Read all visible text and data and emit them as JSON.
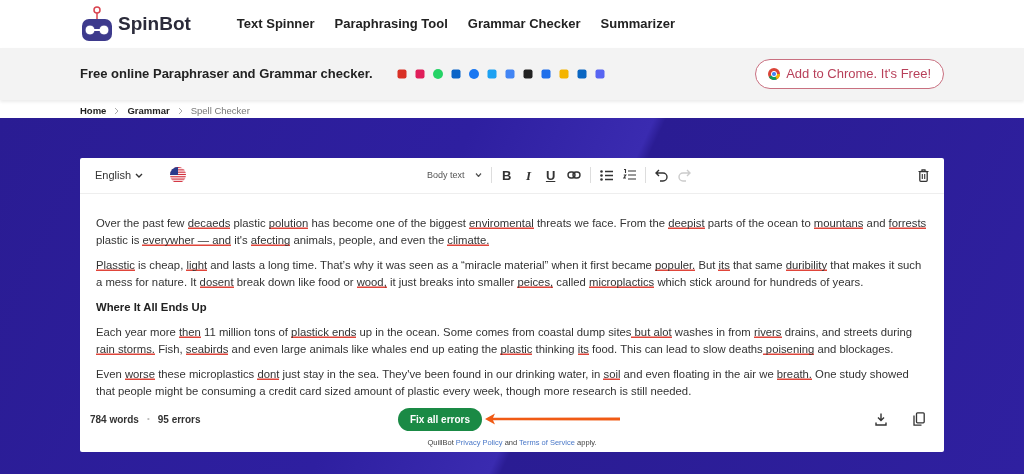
{
  "header": {
    "brand": "SpinBot",
    "nav": [
      {
        "label": "Text Spinner"
      },
      {
        "label": "Paraphrasing Tool"
      },
      {
        "label": "Grammar Checker"
      },
      {
        "label": "Summarizer"
      }
    ]
  },
  "promo": {
    "tagline": "Free online Paraphraser and Grammar checker.",
    "cta": "Add to Chrome. It's Free!"
  },
  "breadcrumb": [
    {
      "label": "Home",
      "current": false
    },
    {
      "label": "Grammar",
      "current": false
    },
    {
      "label": "Spell Checker",
      "current": true
    }
  ],
  "editor": {
    "language": "English",
    "text_style": "Body text",
    "format_buttons": [
      "B",
      "I",
      "U"
    ],
    "history": [
      {
        "kind": "undo",
        "disabled": false
      },
      {
        "kind": "redo",
        "disabled": true
      }
    ],
    "paragraphs": [
      {
        "kind": "text",
        "segments": [
          {
            "text": "Over the past few ",
            "error": false
          },
          {
            "text": "decaeds",
            "error": true
          },
          {
            "text": " plastic ",
            "error": false
          },
          {
            "text": "polution",
            "error": true
          },
          {
            "text": " has become one of the biggest ",
            "error": false
          },
          {
            "text": "enviromental",
            "error": true
          },
          {
            "text": " threats we face. From the ",
            "error": false
          },
          {
            "text": "deepist",
            "error": true
          },
          {
            "text": " parts of the ocean to ",
            "error": false
          },
          {
            "text": "mountans",
            "error": true
          },
          {
            "text": " and ",
            "error": false
          },
          {
            "text": "forrests",
            "error": true
          },
          {
            "text": " plastic is ",
            "error": false
          },
          {
            "text": "everywher — and",
            "error": true
          },
          {
            "text": " it's ",
            "error": false
          },
          {
            "text": "afecting",
            "error": true
          },
          {
            "text": " animals, people, and even the ",
            "error": false
          },
          {
            "text": "climatte.",
            "error": true
          }
        ]
      },
      {
        "kind": "text",
        "segments": [
          {
            "text": "Plasstic",
            "error": true
          },
          {
            "text": " is cheap, ",
            "error": false
          },
          {
            "text": "light",
            "error": true
          },
          {
            "text": " and lasts a long time. That’s why it was seen as a “miracle material” when it first became ",
            "error": false
          },
          {
            "text": "populer.",
            "error": true
          },
          {
            "text": " But ",
            "error": false
          },
          {
            "text": "its",
            "error": true
          },
          {
            "text": " that same ",
            "error": false
          },
          {
            "text": "duribility",
            "error": true
          },
          {
            "text": " that makes it such a mess for nature. It ",
            "error": false
          },
          {
            "text": "dosent",
            "error": true
          },
          {
            "text": " break down like food or ",
            "error": false
          },
          {
            "text": "wood,",
            "error": true
          },
          {
            "text": " it just breaks into smaller ",
            "error": false
          },
          {
            "text": "peices,",
            "error": true
          },
          {
            "text": " called ",
            "error": false
          },
          {
            "text": "microplactics",
            "error": true
          },
          {
            "text": " which stick around for hundreds of years.",
            "error": false
          }
        ]
      },
      {
        "kind": "heading",
        "text": "Where It All Ends Up"
      },
      {
        "kind": "text",
        "segments": [
          {
            "text": "Each year more ",
            "error": false
          },
          {
            "text": "then",
            "error": true
          },
          {
            "text": " 11 million tons of ",
            "error": false
          },
          {
            "text": "plastick ends",
            "error": true
          },
          {
            "text": " up in the ocean. Some comes from coastal dump sites",
            "error": false
          },
          {
            "text": " but alot",
            "error": true
          },
          {
            "text": " washes in from ",
            "error": false
          },
          {
            "text": "rivers",
            "error": true
          },
          {
            "text": " drains, and streets during ",
            "error": false
          },
          {
            "text": "rain storms.",
            "error": true
          },
          {
            "text": " Fish, ",
            "error": false
          },
          {
            "text": "seabirds",
            "error": true
          },
          {
            "text": " and even large animals like whales end up eating the ",
            "error": false
          },
          {
            "text": "plastic",
            "error": true
          },
          {
            "text": " thinking ",
            "error": false
          },
          {
            "text": "its",
            "error": true
          },
          {
            "text": " food. This can lead to slow deaths",
            "error": false
          },
          {
            "text": " poisening",
            "error": true
          },
          {
            "text": " and blockages.",
            "error": false
          }
        ]
      },
      {
        "kind": "text",
        "segments": [
          {
            "text": "Even ",
            "error": false
          },
          {
            "text": "worse",
            "error": true
          },
          {
            "text": " these microplastics ",
            "error": false
          },
          {
            "text": "dont",
            "error": true
          },
          {
            "text": " just stay in the sea. They've been found in our drinking water, in ",
            "error": false
          },
          {
            "text": "soil",
            "error": true
          },
          {
            "text": " and even floating in the air we ",
            "error": false
          },
          {
            "text": "breath.",
            "error": true
          },
          {
            "text": " One study showed that people might be consuming a credit card sized amount of plastic every week, though more research is still needed.",
            "error": false
          }
        ]
      }
    ],
    "stats": {
      "words": "784 words",
      "separator": "•",
      "errors": "95 errors"
    },
    "fix_button": "Fix all errors",
    "legal": [
      {
        "text": "QuillBot ",
        "link": false
      },
      {
        "text": "Privacy Policy",
        "link": true
      },
      {
        "text": " and ",
        "link": false
      },
      {
        "text": "Terms of Service",
        "link": true
      },
      {
        "text": " apply.",
        "link": false
      }
    ]
  }
}
